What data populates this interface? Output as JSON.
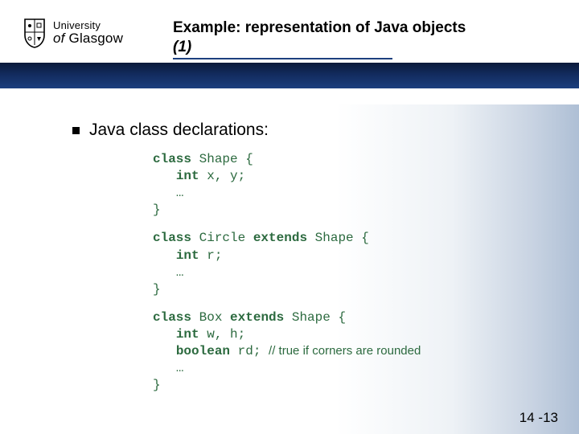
{
  "logo": {
    "university": "University",
    "of_glasgow": "of Glasgow"
  },
  "title": {
    "main": "Example: representation of Java objects",
    "seq": "(1)"
  },
  "bullet": "Java class declarations:",
  "code": {
    "shape": {
      "l1a": "class",
      "l1b": " Shape {",
      "l2a": "int",
      "l2b": " x, y;",
      "l3": "…",
      "l4": "}"
    },
    "circle": {
      "l1a": "class",
      "l1b": " Circle ",
      "l1c": "extends",
      "l1d": " Shape {",
      "l2a": "int",
      "l2b": " r;",
      "l3": "…",
      "l4": "}"
    },
    "box": {
      "l1a": "class",
      "l1b": " Box ",
      "l1c": "extends",
      "l1d": " Shape {",
      "l2a": "int",
      "l2b": " w, h;",
      "l3a": "boolean",
      "l3b": " rd; ",
      "l3c": "// true if corners are rounded",
      "l4": "…",
      "l5": "}"
    }
  },
  "slide_number": "14 -13"
}
